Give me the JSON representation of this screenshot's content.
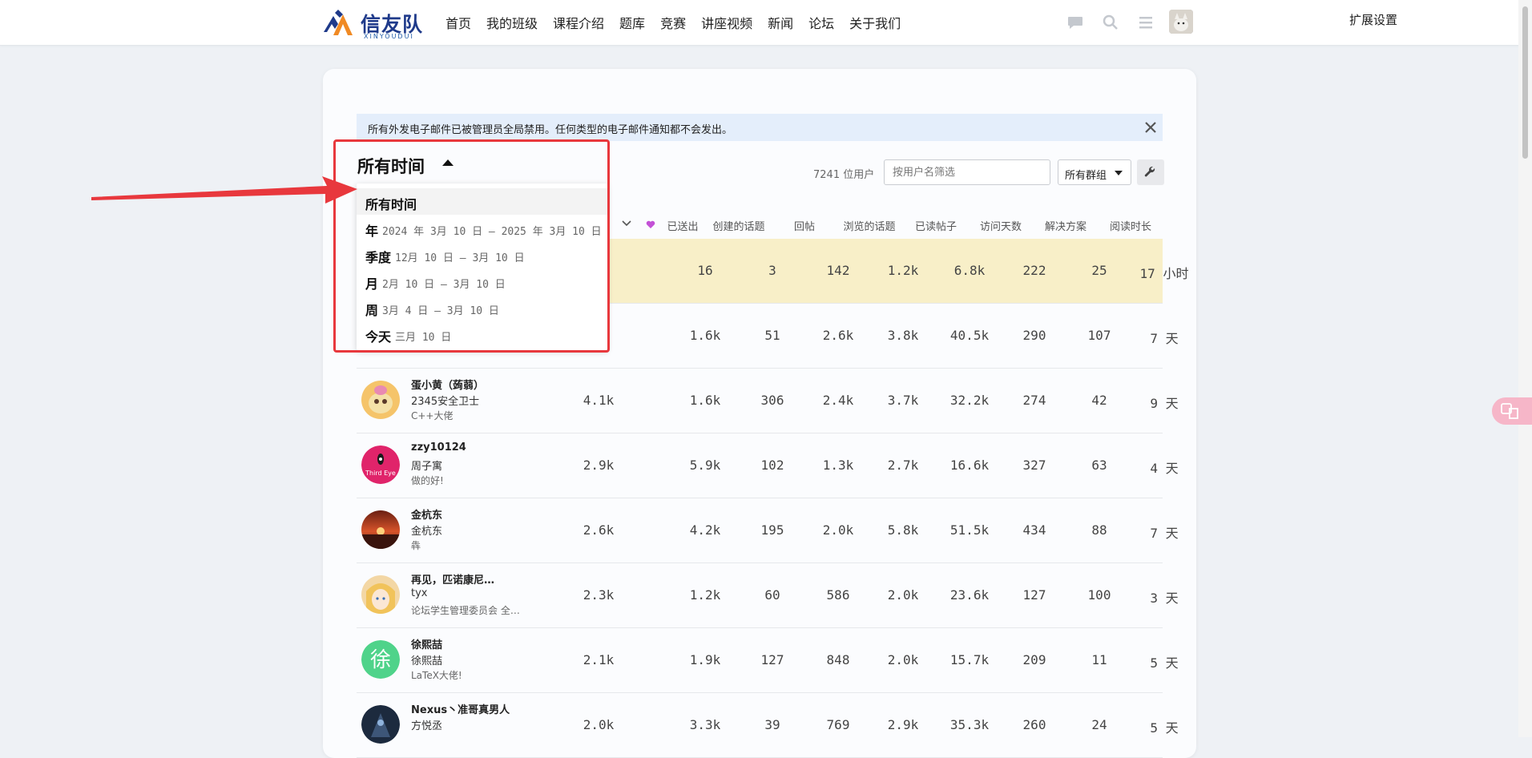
{
  "header": {
    "logo_text": "信友队",
    "logo_sub": "XINYOUDUI",
    "nav": [
      "首页",
      "我的班级",
      "课程介绍",
      "题库",
      "竞赛",
      "讲座视频",
      "新闻",
      "论坛",
      "关于我们"
    ],
    "extension_settings": "扩展设置"
  },
  "notice": {
    "text": "所有外发电子邮件已被管理员全局禁用。任何类型的电子邮件通知都不会发出。"
  },
  "period": {
    "title": "所有时间"
  },
  "filters": {
    "user_count": "7241 位用户",
    "username_placeholder": "按用户名筛选",
    "group_label": "所有群组"
  },
  "columns": {
    "sent": "已送出",
    "topics_created": "创建的话题",
    "replies": "回帖",
    "topics_viewed": "浏览的话题",
    "posts_read": "已读帖子",
    "days_visited": "访问天数",
    "solutions": "解决方案",
    "time_read": "阅读时长"
  },
  "dropdown": {
    "items": [
      {
        "label": "所有时间",
        "range": ""
      },
      {
        "label": "年",
        "range": "2024 年 3月 10 日 – 2025 年 3月 10 日"
      },
      {
        "label": "季度",
        "range": "12月 10 日 – 3月 10 日"
      },
      {
        "label": "月",
        "range": "2月 10 日 – 3月 10 日"
      },
      {
        "label": "周",
        "range": "3月 4 日 – 3月 10 日"
      },
      {
        "label": "今天",
        "range": "三月 10 日"
      }
    ]
  },
  "rows": [
    {
      "name": "",
      "name2": "",
      "title": "",
      "received": "",
      "sent": "16",
      "topics": "3",
      "replies": "142",
      "viewed": "1.2k",
      "read": "6.8k",
      "days": "222",
      "solutions": "25",
      "time": "17 小时",
      "highlight": true
    },
    {
      "name": "",
      "name2": "",
      "title": "",
      "received": "",
      "sent": "1.6k",
      "topics": "51",
      "replies": "2.6k",
      "viewed": "3.8k",
      "read": "40.5k",
      "days": "290",
      "solutions": "107",
      "time": "7 天"
    },
    {
      "name": "蛋小黄（蒟蒻）",
      "name2": "2345安全卫士",
      "title": "C++大佬",
      "received": "4.1k",
      "sent": "1.6k",
      "topics": "306",
      "replies": "2.4k",
      "viewed": "3.7k",
      "read": "32.2k",
      "days": "274",
      "solutions": "42",
      "time": "9 天"
    },
    {
      "name": "zzy10124",
      "name2": "周子寓",
      "title": "做的好!",
      "received": "2.9k",
      "sent": "5.9k",
      "topics": "102",
      "replies": "1.3k",
      "viewed": "2.7k",
      "read": "16.6k",
      "days": "327",
      "solutions": "63",
      "time": "4 天"
    },
    {
      "name": "金杭东",
      "name2": "金杭东",
      "title": "犇",
      "received": "2.6k",
      "sent": "4.2k",
      "topics": "195",
      "replies": "2.0k",
      "viewed": "5.8k",
      "read": "51.5k",
      "days": "434",
      "solutions": "88",
      "time": "7 天"
    },
    {
      "name": "再见，匹诺康尼…",
      "name2": "tyx",
      "title": "论坛学生管理委员会 全…",
      "received": "2.3k",
      "sent": "1.2k",
      "topics": "60",
      "replies": "586",
      "viewed": "2.0k",
      "read": "23.6k",
      "days": "127",
      "solutions": "100",
      "time": "3 天"
    },
    {
      "name": "徐熙喆",
      "name2": "徐熙喆",
      "title": "LaTeX大佬!",
      "received": "2.1k",
      "sent": "1.9k",
      "topics": "127",
      "replies": "848",
      "viewed": "2.0k",
      "read": "15.7k",
      "days": "209",
      "solutions": "11",
      "time": "5 天"
    },
    {
      "name": "Nexus丶准哥真男人",
      "name2": "方悦丞",
      "title": "",
      "received": "2.0k",
      "sent": "3.3k",
      "topics": "39",
      "replies": "769",
      "viewed": "2.9k",
      "read": "35.3k",
      "days": "260",
      "solutions": "24",
      "time": "5 天"
    }
  ],
  "avatars": {
    "third_eye_text": "Third Eye",
    "xu_char": "徐"
  }
}
